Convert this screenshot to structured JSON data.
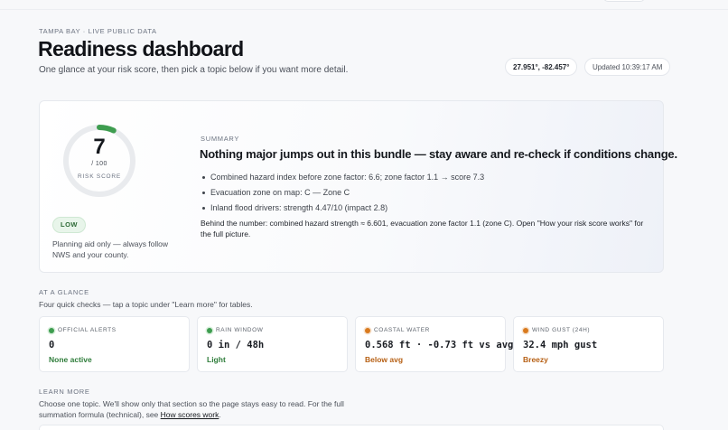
{
  "header": {
    "eyebrow": "TAMPA BAY · LIVE PUBLIC DATA",
    "title": "Readiness dashboard",
    "subtitle": "One glance at your risk score, then pick a topic below if you want more detail.",
    "coords": "27.951°, -82.457°",
    "updated": "Updated 10:39:17 AM"
  },
  "score": {
    "value": "7",
    "max_label": "/ 100",
    "caption": "RISK SCORE",
    "fraction": 0.07,
    "level": "LOW",
    "disclaimer": "Planning aid only — always follow NWS and your county.",
    "gauge_color": "#3e9d4f",
    "track_color": "#e9ebee"
  },
  "summary": {
    "label": "SUMMARY",
    "headline": "Nothing major jumps out in this bundle — stay aware and re-check if conditions change.",
    "bullets": [
      "Combined hazard index before zone factor: 6.6; zone factor 1.1 → score 7.3",
      "Evacuation zone on map: C — Zone C",
      "Inland flood drivers: strength 4.47/10 (impact 2.8)"
    ],
    "note": "Behind the number: combined hazard strength ≈ 6.601, evacuation zone factor 1.1 (zone C). Open \"How your risk score works\" for the full picture."
  },
  "glance": {
    "label": "AT A GLANCE",
    "description": "Four quick checks — tap a topic under \"Learn more\" for tables.",
    "cards": [
      {
        "title": "OFFICIAL ALERTS",
        "value": "0",
        "status": "None active",
        "tone": "green"
      },
      {
        "title": "RAIN WINDOW",
        "value": "0 in / 48h",
        "status": "Light",
        "tone": "green"
      },
      {
        "title": "COASTAL WATER",
        "value": "0.568 ft · -0.73 ft vs avg",
        "status": "Below avg",
        "tone": "orange"
      },
      {
        "title": "WIND GUST (24H)",
        "value": "32.4 mph gust",
        "status": "Breezy",
        "tone": "orange"
      }
    ]
  },
  "learn": {
    "label": "LEARN MORE",
    "description": "Choose one topic. We'll show only that section so the page stays easy to read. For the full summation formula (technical), see ",
    "link": "How scores work",
    "description_end": "."
  }
}
